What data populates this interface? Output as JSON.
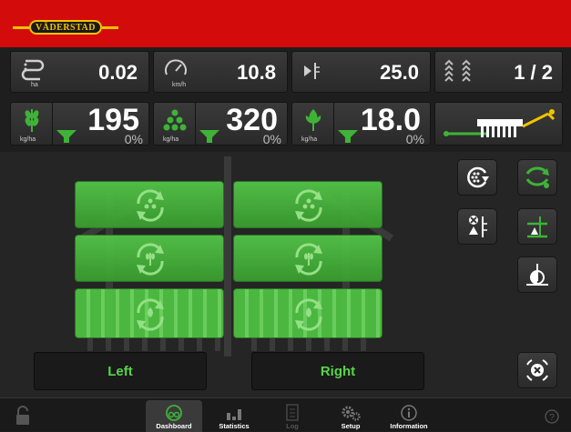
{
  "brand": {
    "logo_text": "VÄDERSTAD",
    "accent": "#d40b0b",
    "logo_color": "#f2c200"
  },
  "metrics_row1": [
    {
      "icon": "field-path-icon",
      "value": "0.02",
      "unit": "ha"
    },
    {
      "icon": "speedometer-icon",
      "value": "10.8",
      "unit": "km/h"
    },
    {
      "icon": "depth-marker-icon",
      "value": "25.0",
      "unit": ""
    },
    {
      "icon": "tramline-icon",
      "value": "1 / 2",
      "unit": ""
    }
  ],
  "metrics_row2": [
    {
      "icon": "wheat-icon",
      "value": "195",
      "unit": "kg/ha",
      "percent": "0%"
    },
    {
      "icon": "fertilizer-granules-icon",
      "value": "320",
      "unit": "kg/ha",
      "percent": "0%"
    },
    {
      "icon": "seed-sprout-icon",
      "value": "18.0",
      "unit": "kg/ha",
      "percent": "0%"
    }
  ],
  "sections": {
    "left_label": "Left",
    "right_label": "Right"
  },
  "nav": [
    {
      "label": "Dashboard",
      "icon": "dashboard-gauge-icon",
      "active": true
    },
    {
      "label": "Statistics",
      "icon": "bar-chart-icon",
      "active": false
    },
    {
      "label": "Log",
      "icon": "log-document-icon",
      "active": false
    },
    {
      "label": "Setup",
      "icon": "gears-icon",
      "active": false
    },
    {
      "label": "Information",
      "icon": "info-icon",
      "active": false
    }
  ],
  "status_colors": {
    "green": "#3aa02f",
    "bright_green": "#58d44a"
  }
}
